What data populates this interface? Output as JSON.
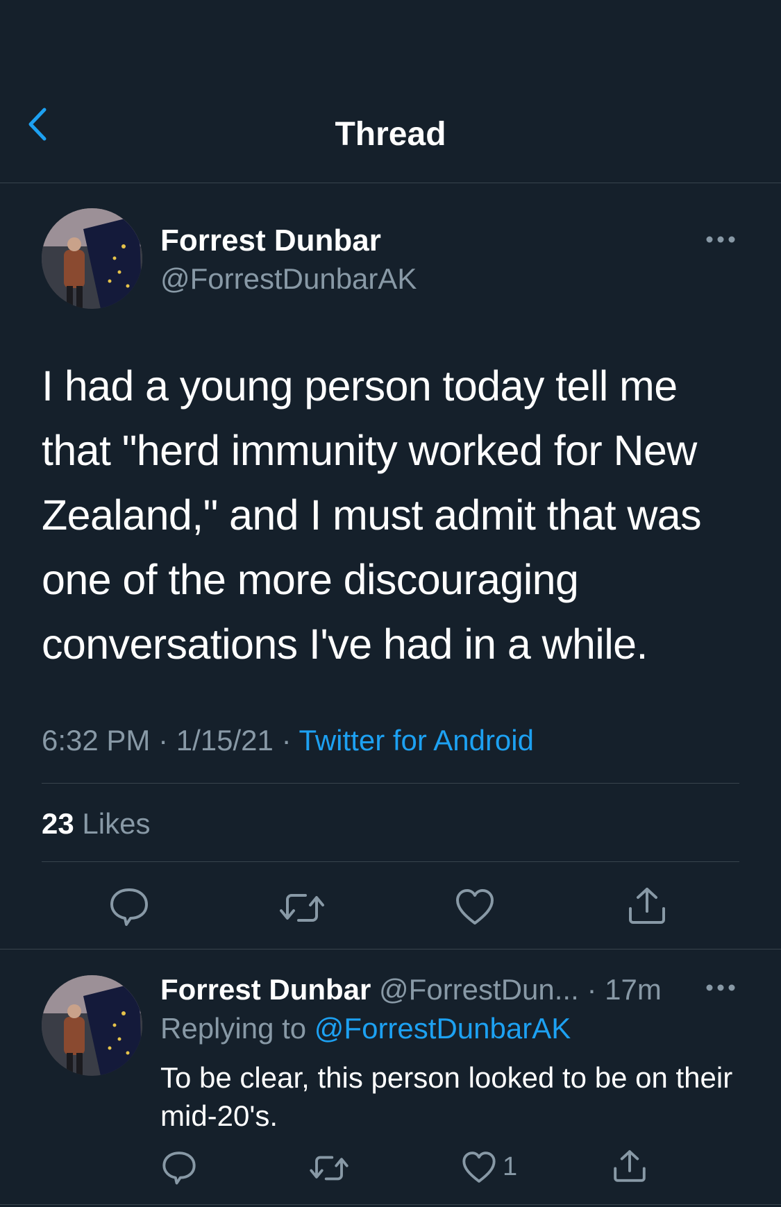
{
  "header": {
    "title": "Thread"
  },
  "main_tweet": {
    "author_name": "Forrest Dunbar",
    "author_handle": "@ForrestDunbarAK",
    "text": "I had a young person today tell me that \"herd immunity worked for New Zealand,\" and I must admit that was one of the more discouraging conversations I've had in a while.",
    "time": "6:32 PM",
    "sep1": "·",
    "date": "1/15/21",
    "sep2": "·",
    "source": "Twitter for Android",
    "likes_count": "23",
    "likes_label": "Likes"
  },
  "reply": {
    "author_name": "Forrest Dunbar",
    "author_handle": "@ForrestDun...",
    "sep": "·",
    "time": "17m",
    "replying_label": "Replying to",
    "replying_handle": "@ForrestDunbarAK",
    "text": "To be clear, this person looked to be on their mid-20's.",
    "like_count": "1"
  },
  "colors": {
    "background": "#15202b",
    "accent": "#1da1f2",
    "muted": "#8899a6",
    "divider": "#38444d"
  },
  "icons": [
    "back-chevron-icon",
    "more-icon",
    "reply-icon",
    "retweet-icon",
    "like-icon",
    "share-icon"
  ]
}
